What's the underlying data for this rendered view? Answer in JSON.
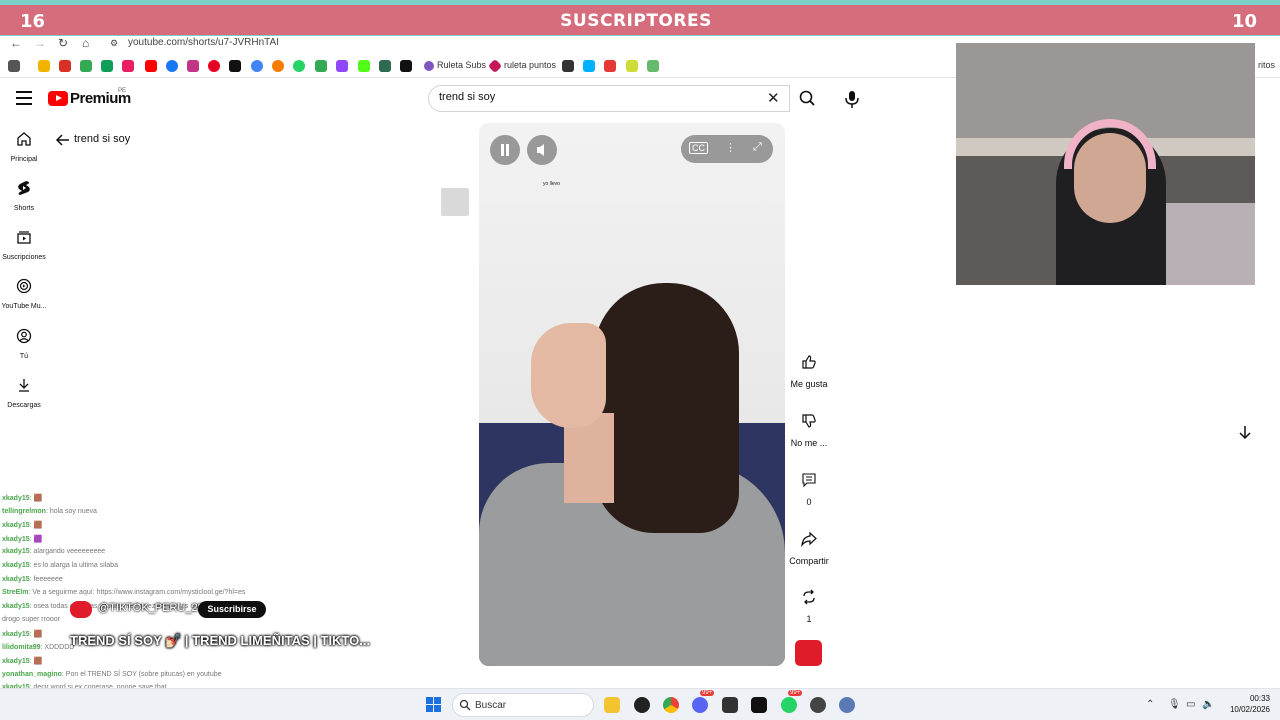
{
  "overlay": {
    "left_count": "16",
    "title": "SUSCRIPTORES",
    "right_count": "10"
  },
  "browser": {
    "url": "youtube.com/shorts/u7-JVRHnTAI",
    "bookmarks": [
      {
        "label": "Ruleta Subs"
      },
      {
        "label": "ruleta puntos"
      }
    ],
    "right_edge_text": "ritos"
  },
  "youtube": {
    "logo_text": "Premium",
    "region": "PE",
    "search": {
      "value": "trend si soy",
      "placeholder": "Buscar"
    },
    "sidebar": [
      {
        "label": "Principal",
        "icon": "home-icon"
      },
      {
        "label": "Shorts",
        "icon": "shorts-icon"
      },
      {
        "label": "Suscripciones",
        "icon": "subscriptions-icon"
      },
      {
        "label": "YouTube Mu...",
        "icon": "youtube-music-icon"
      },
      {
        "label": "Tú",
        "icon": "you-icon"
      },
      {
        "label": "Descargas",
        "icon": "downloads-icon"
      }
    ],
    "back_label": "trend si soy",
    "video_label": "yo llevo",
    "actions": {
      "like_label": "Me gusta",
      "dislike_label": "No me ...",
      "comments_count": "0",
      "share_label": "Compartir",
      "remix_count": "1"
    },
    "channel_handle": "@TIKTOK_PERU_28",
    "subscribe_label": "Suscribirse",
    "video_title": "TREND SÍ SOY 💅🏻 | TREND LIMEÑITAS  | TIKTO..."
  },
  "chat": [
    {
      "user": "xkady15",
      "message": ": 🟫"
    },
    {
      "user": "tellingrelmon",
      "message": ": hola soy nueva"
    },
    {
      "user": "xkady15",
      "message": ": 🟫"
    },
    {
      "user": "xkady15",
      "message": ": 🟪"
    },
    {
      "user": "xkady15",
      "message": ": alargando veeeeeeeee"
    },
    {
      "user": "xkady15",
      "message": ": es lo alarga la ultima silaba"
    },
    {
      "user": "xkady15",
      "message": ": feeeeeee"
    },
    {
      "user": "StreElm",
      "message": ": Ve a seguirme aquí: https://www.instagram.com/mysticlool.ge/?hl=es"
    },
    {
      "user": "xkady15",
      "message": ": osea todas estas las pitucas media vez lima, y las que tienen que ver"
    },
    {
      "user": "",
      "message": "drogo super rrooor"
    },
    {
      "user": "xkady15",
      "message": ": 🟫"
    },
    {
      "user": "lilidomita99",
      "message": ": XDDDDD"
    },
    {
      "user": "xkady15",
      "message": ": 🟫"
    },
    {
      "user": "yonathan_magino",
      "message": ": Pon el TREND SÍ SOY (sobre pitucas) en youtube"
    },
    {
      "user": "xkady15",
      "message": ": decir word si ex conerase, noone saye that"
    },
    {
      "user": "Ttyzelie19",
      "message": ": 🟫"
    }
  ],
  "taskbar": {
    "search_label": "Buscar",
    "badge_chat": "99+",
    "badge_whatsapp": "99+",
    "time": "00:33",
    "date": "10/02/2026"
  },
  "colors": {
    "banner": "#d56d7c",
    "banner_border": "#7bcfc6",
    "youtube_red": "#ff0000",
    "chat_user": "#4aa64a"
  }
}
